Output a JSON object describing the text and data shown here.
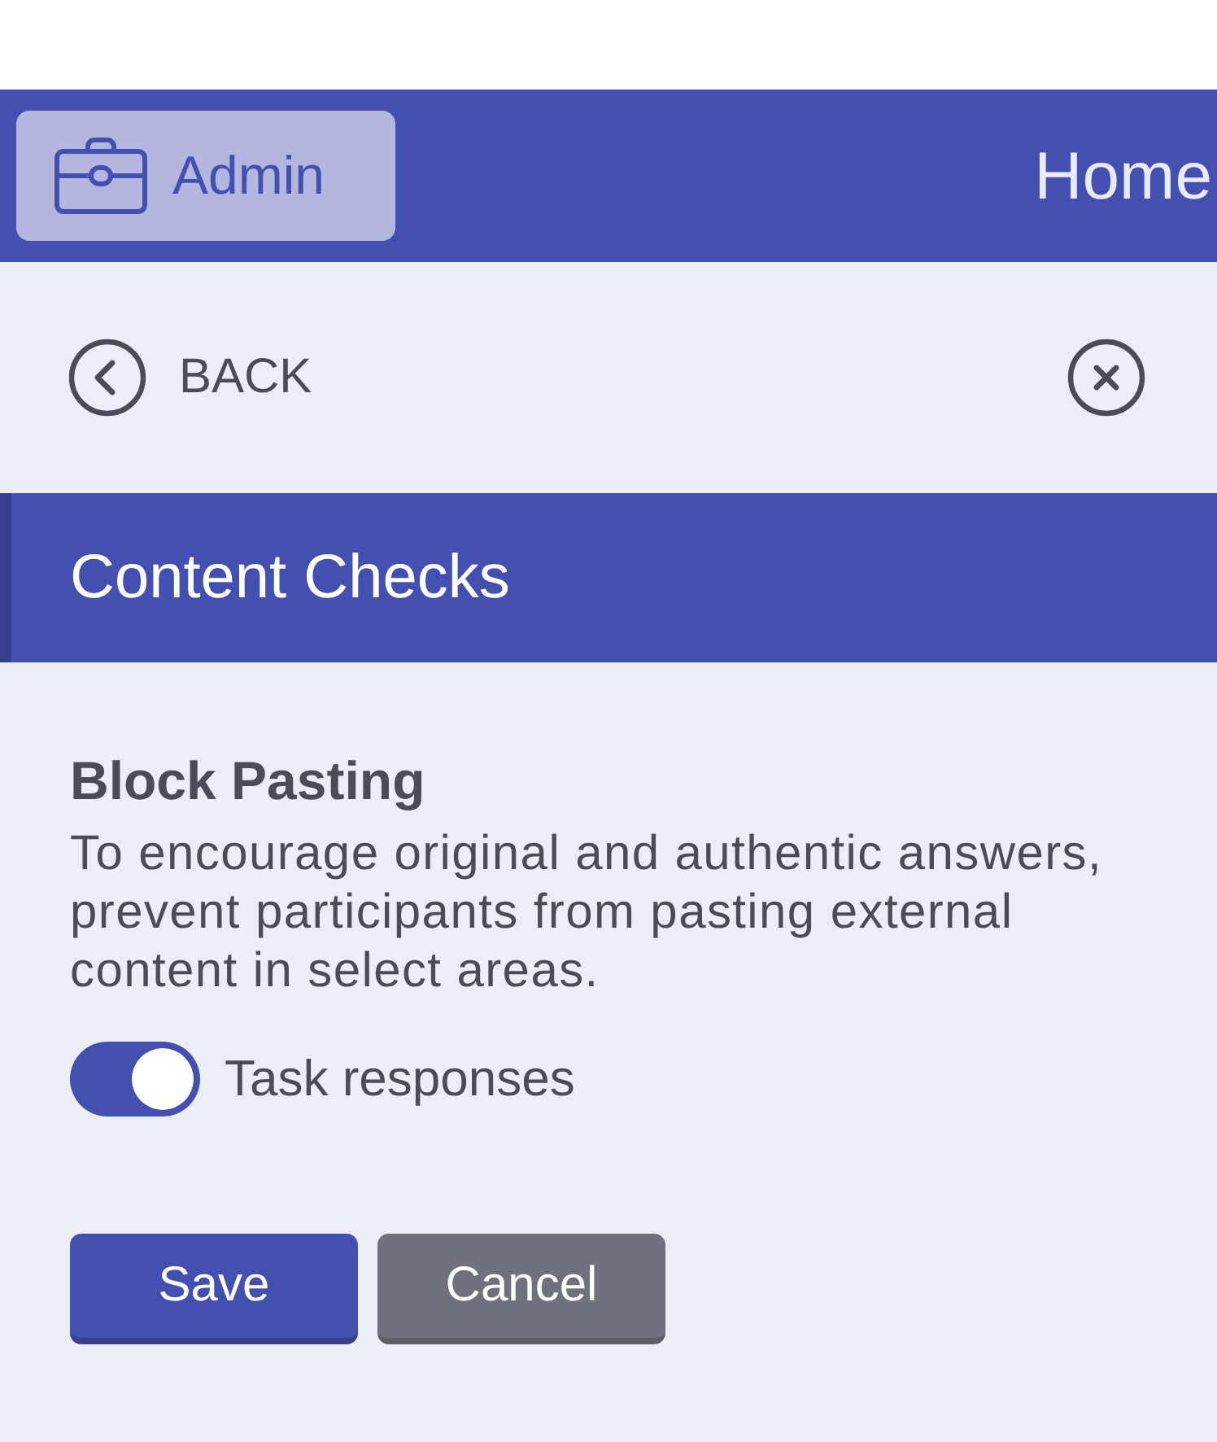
{
  "header": {
    "admin_button": {
      "label": "Admin"
    },
    "title": "Home"
  },
  "nav": {
    "back": {
      "label": "BACK"
    }
  },
  "section": {
    "title": "Content Checks"
  },
  "setting": {
    "title": "Block Pasting",
    "description": "To encourage original and authentic answers, prevent participants from pasting external content in select areas.",
    "toggles": [
      {
        "label": "Task responses",
        "on": true
      }
    ]
  },
  "buttons": [
    {
      "label": "Save",
      "kind": "primary"
    },
    {
      "label": "Cancel",
      "kind": "secondary"
    }
  ]
}
